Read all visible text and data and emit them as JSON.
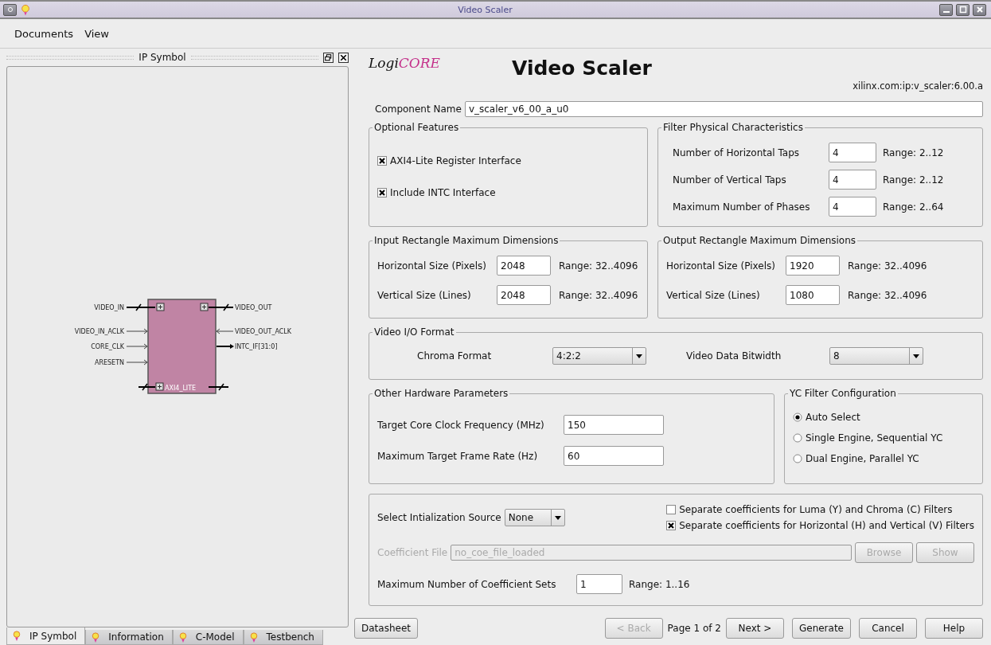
{
  "window": {
    "title": "Video Scaler"
  },
  "menu": [
    "Documents",
    "View"
  ],
  "left_panel": {
    "title": "IP Symbol",
    "symbol": {
      "left_ports": [
        {
          "label": "VIDEO_IN",
          "kind": "bus"
        },
        {
          "label": "VIDEO_IN_ACLK",
          "kind": "input"
        },
        {
          "label": "CORE_CLK",
          "kind": "input"
        },
        {
          "label": "ARESETN",
          "kind": "input"
        }
      ],
      "right_ports": [
        {
          "label": "VIDEO_OUT",
          "kind": "bus"
        },
        {
          "label": "VIDEO_OUT_ACLK",
          "kind": "input"
        },
        {
          "label": "INTC_IF[31:0]",
          "kind": "output"
        }
      ],
      "bottom_port": "AXI4_LITE"
    },
    "tabs": [
      {
        "label": "IP Symbol",
        "selected": true
      },
      {
        "label": "Information",
        "selected": false
      },
      {
        "label": "C-Model",
        "selected": false
      },
      {
        "label": "Testbench",
        "selected": false
      }
    ]
  },
  "header": {
    "logo_a": "Logi",
    "logo_b": "CORE",
    "title": "Video Scaler",
    "vlnv": "xilinx.com:ip:v_scaler:6.00.a"
  },
  "component_name": {
    "label": "Component Name",
    "value": "v_scaler_v6_00_a_u0"
  },
  "optional_features": {
    "title": "Optional Features",
    "items": [
      {
        "label": "AXI4-Lite Register Interface",
        "checked": true
      },
      {
        "label": "Include INTC Interface",
        "checked": true
      }
    ]
  },
  "filter_physical": {
    "title": "Filter Physical Characteristics",
    "rows": [
      {
        "label": "Number of Horizontal Taps",
        "value": "4",
        "range": "Range: 2..12"
      },
      {
        "label": "Number of Vertical Taps",
        "value": "4",
        "range": "Range: 2..12"
      },
      {
        "label": "Maximum Number of Phases",
        "value": "4",
        "range": "Range: 2..64"
      }
    ]
  },
  "input_rect": {
    "title": "Input Rectangle Maximum Dimensions",
    "rows": [
      {
        "label": "Horizontal Size (Pixels)",
        "value": "2048",
        "range": "Range: 32..4096"
      },
      {
        "label": "Vertical Size (Lines)",
        "value": "2048",
        "range": "Range: 32..4096"
      }
    ]
  },
  "output_rect": {
    "title": "Output Rectangle Maximum Dimensions",
    "rows": [
      {
        "label": "Horizontal Size (Pixels)",
        "value": "1920",
        "range": "Range: 32..4096"
      },
      {
        "label": "Vertical Size (Lines)",
        "value": "1080",
        "range": "Range: 32..4096"
      }
    ]
  },
  "video_io": {
    "title": "Video I/O Format",
    "fields": [
      {
        "label": "Chroma Format",
        "value": "4:2:2"
      },
      {
        "label": "Video Data Bitwidth",
        "value": "8"
      }
    ]
  },
  "other_hw": {
    "title": "Other Hardware Parameters",
    "rows": [
      {
        "label": "Target Core Clock Frequency (MHz)",
        "value": "150"
      },
      {
        "label": "Maximum Target Frame Rate (Hz)",
        "value": "60"
      }
    ]
  },
  "yc_filter": {
    "title": "YC Filter Configuration",
    "options": [
      {
        "label": "Auto Select",
        "selected": true
      },
      {
        "label": "Single Engine, Sequential YC",
        "selected": false
      },
      {
        "label": "Dual Engine, Parallel YC",
        "selected": false
      }
    ]
  },
  "coefficients": {
    "init_label": "Select Intialization Source",
    "init_value": "None",
    "checks": [
      {
        "label": "Separate coefficients for Luma (Y) and Chroma (C) Filters",
        "checked": false
      },
      {
        "label": "Separate coefficients for Horizontal (H) and Vertical (V) Filters",
        "checked": true
      }
    ],
    "file": {
      "label": "Coefficient File",
      "value": "no_coe_file_loaded",
      "disabled": true
    },
    "buttons": [
      {
        "label": "Browse",
        "disabled": true
      },
      {
        "label": "Show",
        "disabled": true
      }
    ],
    "max_sets": {
      "label": "Maximum Number of Coefficient Sets",
      "value": "1",
      "range": "Range: 1..16"
    }
  },
  "footer": {
    "datasheet": "Datasheet",
    "back": {
      "label": "< Back",
      "disabled": true
    },
    "page": "Page 1 of 2",
    "buttons": [
      {
        "label": "Next >",
        "disabled": false
      },
      {
        "label": "Generate",
        "disabled": false
      },
      {
        "label": "Cancel",
        "disabled": false
      },
      {
        "label": "Help",
        "disabled": false
      }
    ]
  }
}
